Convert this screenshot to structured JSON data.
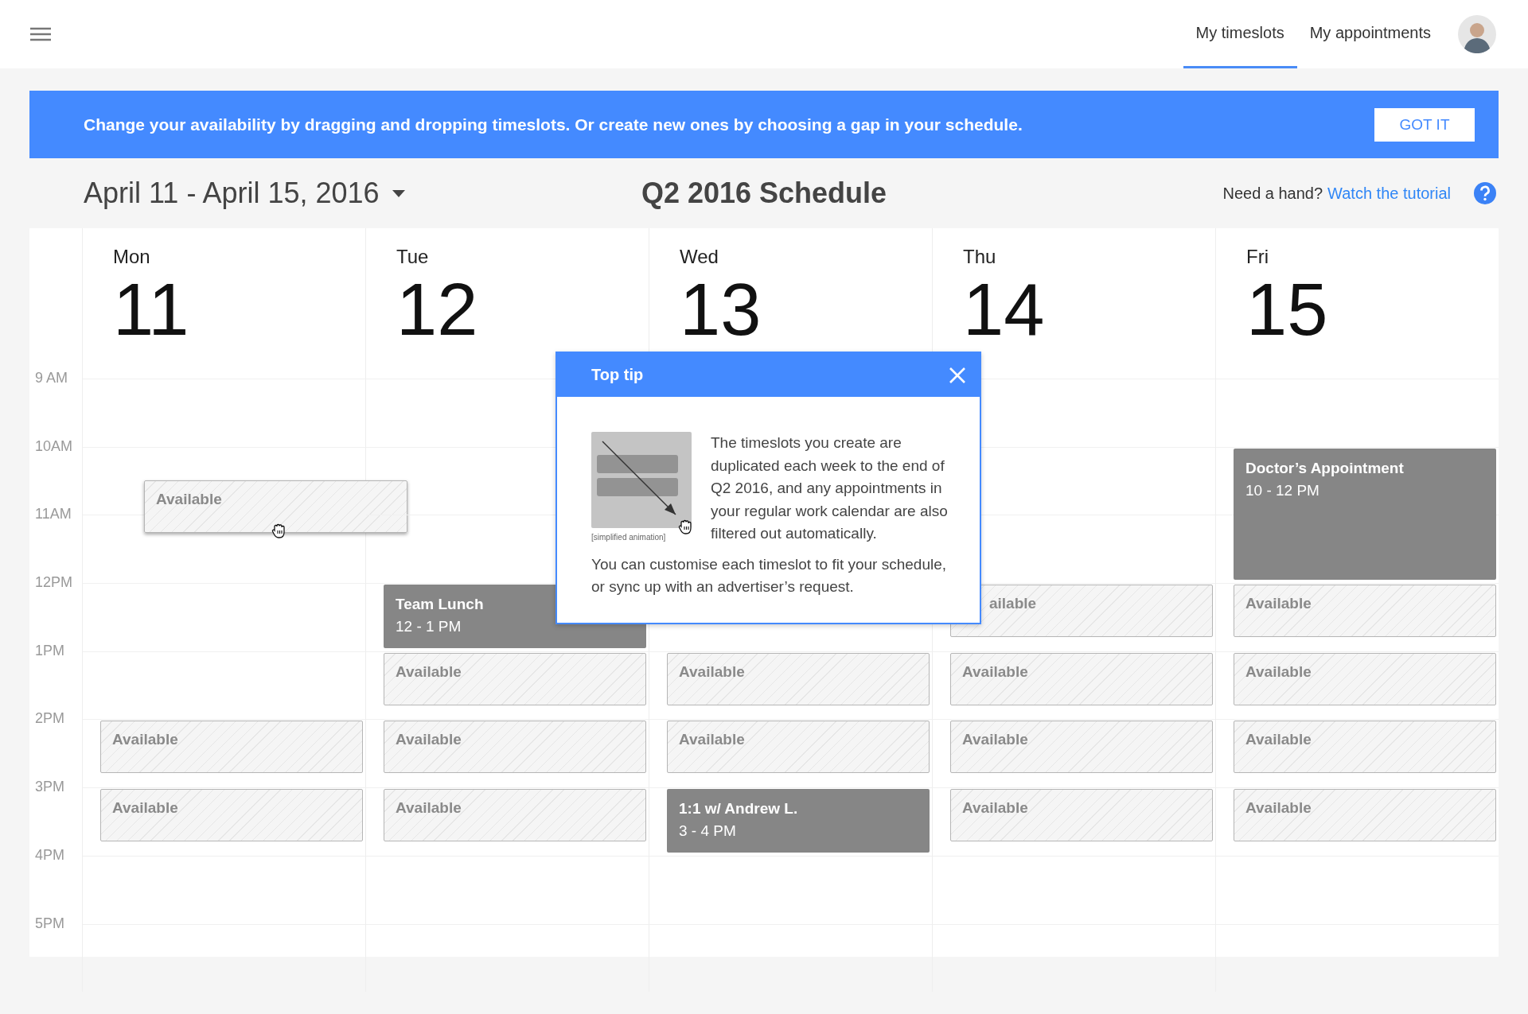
{
  "header": {
    "tabs": [
      {
        "label": "My timeslots",
        "selected": true
      },
      {
        "label": "My appointments",
        "selected": false
      }
    ]
  },
  "banner": {
    "text": "Change your availability by dragging and dropping timeslots. Or create new ones by choosing a gap in your schedule.",
    "button": "GOT IT"
  },
  "toolbar": {
    "date_range": "April 11 - April 15, 2016",
    "title": "Q2 2016 Schedule",
    "help_text": "Need a hand?",
    "help_link": "Watch the tutorial"
  },
  "hours": [
    "9 AM",
    "10AM",
    "11AM",
    "12PM",
    "1PM",
    "2PM",
    "3PM",
    "4PM",
    "5PM"
  ],
  "days": [
    {
      "name": "Mon",
      "date": "11",
      "dragged_slot": {
        "title": "Available"
      },
      "cells": [
        {
          "kind": "empty"
        },
        {
          "kind": "empty"
        },
        {
          "kind": "empty"
        },
        {
          "kind": "empty"
        },
        {
          "kind": "empty"
        },
        {
          "kind": "available",
          "title": "Available"
        },
        {
          "kind": "available",
          "title": "Available"
        },
        {
          "kind": "empty"
        }
      ]
    },
    {
      "name": "Tue",
      "date": "12",
      "cells": [
        {
          "kind": "empty"
        },
        {
          "kind": "empty"
        },
        {
          "kind": "empty"
        },
        {
          "kind": "appointment",
          "title": "Team Lunch",
          "time": "12 - 1 PM"
        },
        {
          "kind": "available",
          "title": "Available"
        },
        {
          "kind": "available",
          "title": "Available"
        },
        {
          "kind": "available",
          "title": "Available"
        },
        {
          "kind": "empty"
        }
      ]
    },
    {
      "name": "Wed",
      "date": "13",
      "cells": [
        {
          "kind": "empty"
        },
        {
          "kind": "empty"
        },
        {
          "kind": "empty"
        },
        {
          "kind": "empty"
        },
        {
          "kind": "available",
          "title": "Available"
        },
        {
          "kind": "available",
          "title": "Available"
        },
        {
          "kind": "appointment",
          "title": "1:1 w/ Andrew L.",
          "time": "3 - 4 PM"
        },
        {
          "kind": "empty"
        }
      ]
    },
    {
      "name": "Thu",
      "date": "14",
      "cells": [
        {
          "kind": "empty"
        },
        {
          "kind": "empty"
        },
        {
          "kind": "empty"
        },
        {
          "kind": "partial",
          "title": "ailable"
        },
        {
          "kind": "available",
          "title": "Available"
        },
        {
          "kind": "available",
          "title": "Available"
        },
        {
          "kind": "available",
          "title": "Available"
        },
        {
          "kind": "empty"
        }
      ]
    },
    {
      "name": "Fri",
      "date": "15",
      "cells": [
        {
          "kind": "empty"
        },
        {
          "kind": "appointment",
          "title": "Doctor’s Appointment",
          "time": "10 - 12 PM"
        },
        {
          "kind": "continued"
        },
        {
          "kind": "available",
          "title": "Available"
        },
        {
          "kind": "available",
          "title": "Available"
        },
        {
          "kind": "available",
          "title": "Available"
        },
        {
          "kind": "available",
          "title": "Available"
        },
        {
          "kind": "empty"
        }
      ]
    }
  ],
  "popup": {
    "title": "Top tip",
    "caption": "[simplified animation]",
    "text": "The timeslots you create are duplicated each week to the end of Q2 2016, and any appointments in your regular work calendar are also filtered out automatically.",
    "note": "You can customise each timeslot to fit your schedule, or sync up with an advertiser’s request."
  }
}
